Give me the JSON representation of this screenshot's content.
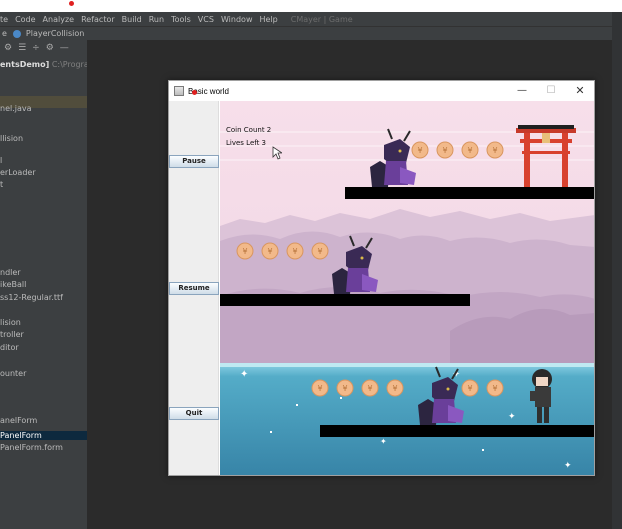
{
  "ide": {
    "menu_items": [
      "te",
      "Code",
      "Analyze",
      "Refactor",
      "Build",
      "Run",
      "Tools",
      "VCS",
      "Window",
      "Help"
    ],
    "project_title": "CMayer | Game",
    "breadcrumb_start": "e",
    "breadcrumb_file": "PlayerCollision",
    "project_root_name": "entsDemo]",
    "project_root_path": "C:\\Programmi",
    "tree_items": [
      "nel.java",
      "llision",
      "l",
      "erLoader",
      "t",
      "ndler",
      "ikeBall",
      "ss12-Regular.ttf",
      "lision",
      "troller",
      "ditor",
      "ounter",
      "anelForm",
      "PanelForm",
      "PanelForm.form"
    ],
    "selected_tree_item_index": 13
  },
  "window": {
    "title": "Basic world",
    "minimize_glyph": "—",
    "maximize_glyph": "☐",
    "close_glyph": "✕"
  },
  "buttons": {
    "pause": "Pause",
    "resume": "Resume",
    "quit": "Quit"
  },
  "hud": {
    "coin_count": "Coin Count 2",
    "lives_left": "Lives Left 3"
  },
  "scene": {
    "sky_color": "#f4dbe7",
    "water_color": "#3e9bb8",
    "platform_color": "#000000",
    "coin_color": "#f2b98a",
    "coin_symbol": "¥",
    "player_color": "#4b2f6e",
    "enemy_color": "#2c2c2c",
    "gate_color": "#d8412e",
    "coins_row1_count": 4,
    "coins_row2_count": 4,
    "coins_row3_count": 6
  }
}
